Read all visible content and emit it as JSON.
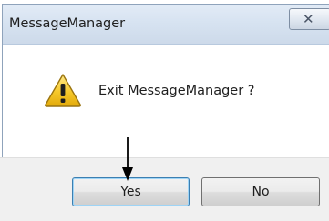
{
  "window": {
    "title": "MessageManager",
    "close_glyph": "✕"
  },
  "message": {
    "text": "Exit MessageManager ?",
    "icon": "warning-icon"
  },
  "buttons": {
    "yes_label": "Yes",
    "no_label": "No"
  },
  "annotation": {
    "arrow_target": "Yes"
  }
}
